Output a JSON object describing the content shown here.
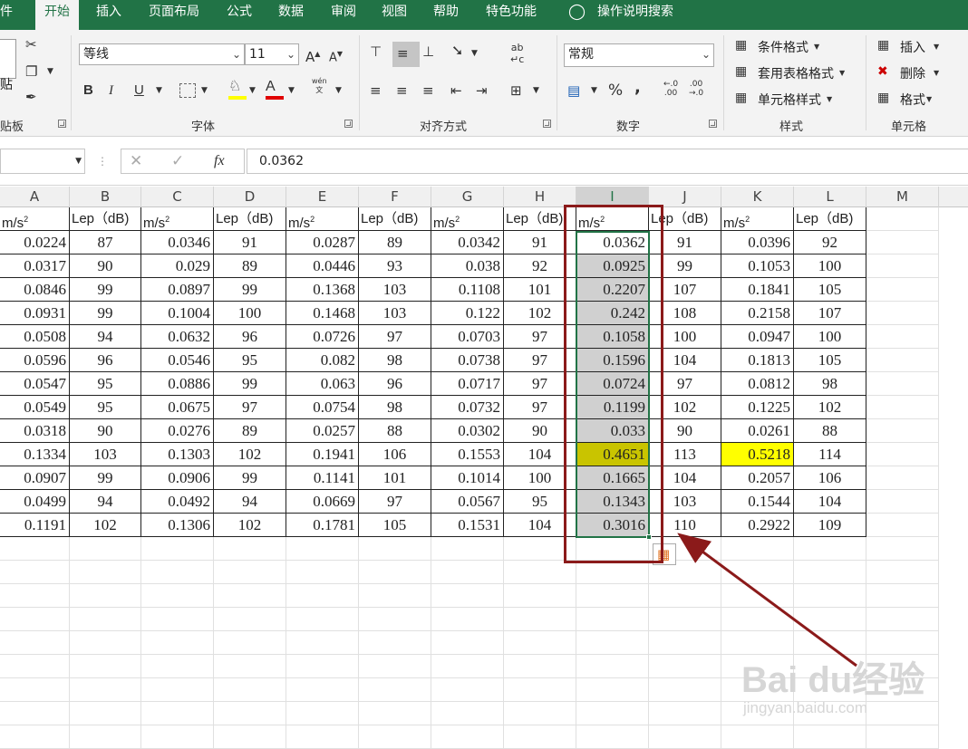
{
  "tabs": [
    "件",
    "开始",
    "插入",
    "页面布局",
    "公式",
    "数据",
    "审阅",
    "视图",
    "帮助",
    "特色功能"
  ],
  "tab_active": "开始",
  "tell_me": "操作说明搜索",
  "ribbon": {
    "clipboard": {
      "paste": "贴",
      "label": "贴板"
    },
    "font": {
      "name": "等线",
      "size": "11",
      "grow": "A",
      "shrink": "A",
      "bold": "B",
      "italic": "I",
      "underline": "U",
      "font_color": "A",
      "phonetic": "wén",
      "label": "字体"
    },
    "alignment": {
      "label": "对齐方式"
    },
    "number": {
      "format": "常规",
      "percent": "%",
      "comma": ",",
      "label": "数字"
    },
    "styles": {
      "conditional": "条件格式",
      "table": "套用表格格式",
      "cell": "单元格样式",
      "label": "样式"
    },
    "cells": {
      "insert": "插入",
      "delete": "删除",
      "format": "格式",
      "label": "单元格"
    }
  },
  "formula_bar": {
    "fx": "fx",
    "value": "0.0362"
  },
  "columns": [
    "A",
    "B",
    "C",
    "D",
    "E",
    "F",
    "G",
    "H",
    "I",
    "J",
    "K",
    "L",
    "M"
  ],
  "selected_column": "I",
  "header_row": [
    "m/s",
    "Lep（dB)",
    "m/s",
    "Lep（dB)",
    "m/s",
    "Lep（dB)",
    "m/s",
    "Lep（dB)",
    "m/s",
    "Lep（dB)",
    "m/s",
    "Lep（dB)"
  ],
  "header_sup": "2",
  "rows": [
    [
      "0.0224",
      "87",
      "0.0346",
      "91",
      "0.0287",
      "89",
      "0.0342",
      "91",
      "0.0362",
      "91",
      "0.0396",
      "92"
    ],
    [
      "0.0317",
      "90",
      "0.029",
      "89",
      "0.0446",
      "93",
      "0.038",
      "92",
      "0.0925",
      "99",
      "0.1053",
      "100"
    ],
    [
      "0.0846",
      "99",
      "0.0897",
      "99",
      "0.1368",
      "103",
      "0.1108",
      "101",
      "0.2207",
      "107",
      "0.1841",
      "105"
    ],
    [
      "0.0931",
      "99",
      "0.1004",
      "100",
      "0.1468",
      "103",
      "0.122",
      "102",
      "0.242",
      "108",
      "0.2158",
      "107"
    ],
    [
      "0.0508",
      "94",
      "0.0632",
      "96",
      "0.0726",
      "97",
      "0.0703",
      "97",
      "0.1058",
      "100",
      "0.0947",
      "100"
    ],
    [
      "0.0596",
      "96",
      "0.0546",
      "95",
      "0.082",
      "98",
      "0.0738",
      "97",
      "0.1596",
      "104",
      "0.1813",
      "105"
    ],
    [
      "0.0547",
      "95",
      "0.0886",
      "99",
      "0.063",
      "96",
      "0.0717",
      "97",
      "0.0724",
      "97",
      "0.0812",
      "98"
    ],
    [
      "0.0549",
      "95",
      "0.0675",
      "97",
      "0.0754",
      "98",
      "0.0732",
      "97",
      "0.1199",
      "102",
      "0.1225",
      "102"
    ],
    [
      "0.0318",
      "90",
      "0.0276",
      "89",
      "0.0257",
      "88",
      "0.0302",
      "90",
      "0.033",
      "90",
      "0.0261",
      "88"
    ],
    [
      "0.1334",
      "103",
      "0.1303",
      "102",
      "0.1941",
      "106",
      "0.1553",
      "104",
      "0.4651",
      "113",
      "0.5218",
      "114"
    ],
    [
      "0.0907",
      "99",
      "0.0906",
      "99",
      "0.1141",
      "101",
      "0.1014",
      "100",
      "0.1665",
      "104",
      "0.2057",
      "106"
    ],
    [
      "0.0499",
      "94",
      "0.0492",
      "94",
      "0.0669",
      "97",
      "0.0567",
      "95",
      "0.1343",
      "103",
      "0.1544",
      "104"
    ],
    [
      "0.1191",
      "102",
      "0.1306",
      "102",
      "0.1781",
      "105",
      "0.1531",
      "104",
      "0.3016",
      "110",
      "0.2922",
      "109"
    ]
  ],
  "highlights": {
    "olive": "#c9c400",
    "yellow": "#ffff00",
    "accent": "#217346",
    "annotation": "#8b1a1a"
  },
  "watermark": {
    "brand": "Bai du",
    "brand_cn": "经验",
    "url": "jingyan.baidu.com"
  }
}
